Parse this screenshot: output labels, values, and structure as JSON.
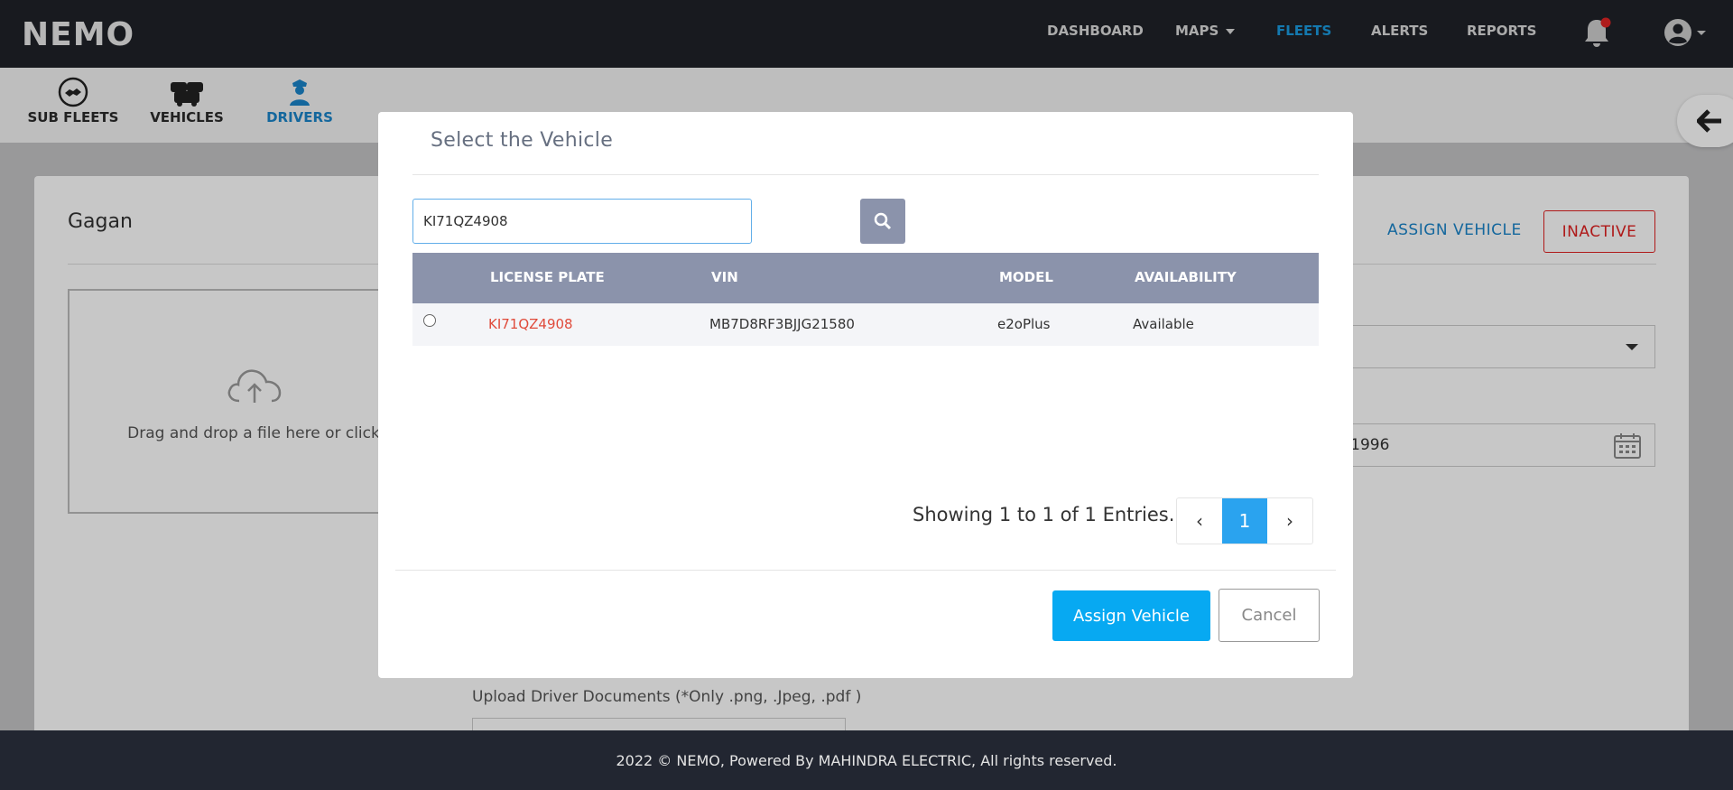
{
  "header": {
    "logo": "NEMO",
    "nav": [
      "DASHBOARD",
      "MAPS",
      "FLEETS",
      "ALERTS",
      "REPORTS"
    ],
    "active_nav": "FLEETS",
    "accent": "#1a9be0"
  },
  "subnav": {
    "tabs": [
      "SUB FLEETS",
      "VEHICLES",
      "DRIVERS"
    ],
    "active": "DRIVERS"
  },
  "driver": {
    "name": "Gagan",
    "assign_label": "ASSIGN VEHICLE",
    "inactive_label": "INACTIVE",
    "dropzone_text": "Drag and drop a file here or click",
    "dob_partial": "-1996",
    "upload_docs_label": "Upload Driver Documents (*Only .png, .Jpeg, .pdf )"
  },
  "modal": {
    "title": "Select the Vehicle",
    "search_value": "KI71QZ4908",
    "columns": [
      "LICENSE PLATE",
      "VIN",
      "MODEL",
      "AVAILABILITY"
    ],
    "rows": [
      {
        "license_plate": "KI71QZ4908",
        "vin": "MB7D8RF3BJJG21580",
        "model": "e2oPlus",
        "availability": "Available"
      }
    ],
    "showing_text": "Showing 1 to 1 of 1 Entries.",
    "current_page": "1",
    "prev_label": "‹",
    "next_label": "›",
    "assign_button": "Assign Vehicle",
    "cancel_button": "Cancel"
  },
  "footer": {
    "text": "2022 © NEMO, Powered By MAHINDRA ELECTRIC, All rights reserved."
  }
}
